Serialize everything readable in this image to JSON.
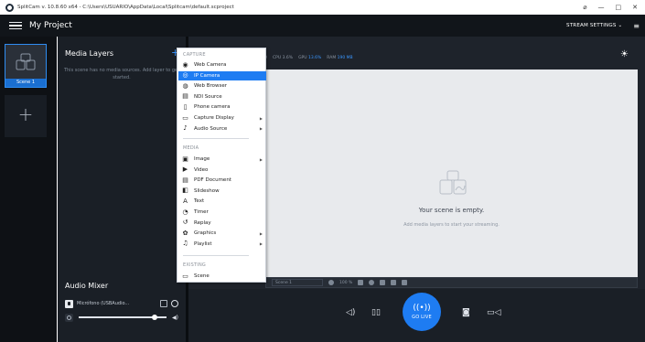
{
  "window": {
    "title": "SplitCam v. 10.8.60 x64 - C:\\Users\\USUARIO\\AppData\\Local\\Splitcam\\default.scproject",
    "minimize": "—",
    "maximize": "□",
    "close": "✕",
    "pin": "⌀"
  },
  "header": {
    "project_title": "My Project",
    "stream_settings": "STREAM SETTINGS  ⌄"
  },
  "scenes": {
    "items": [
      {
        "label": "Scene 1"
      }
    ],
    "add_label": "+"
  },
  "layers": {
    "title": "Media Layers",
    "add_label": "+",
    "empty_text": "This scene has no media sources. Add layer to get started."
  },
  "stats": {
    "fps": "5 10",
    "cpu_label": "CPU",
    "cpu": "3.6%",
    "gpu_label": "GPU",
    "gpu": "13.6%",
    "ram_label": "RAM",
    "ram": "190 MB"
  },
  "canvas": {
    "empty_title": "Your scene is empty.",
    "empty_sub": "Add media layers to start your streaming.",
    "scene_select": "Scene 1",
    "zoom": "100 %"
  },
  "audio": {
    "title": "Audio Mixer",
    "device": "Micrófono (USBAudio...",
    "volume": 0.86
  },
  "bottom": {
    "go_live": "GO LIVE"
  },
  "menu": {
    "capture_header": "CAPTURE",
    "media_header": "MEDIA",
    "existing_header": "EXISTING",
    "capture_items": [
      {
        "label": "Web Camera",
        "icon": "webcam-icon",
        "glyph": "◉",
        "submenu": false,
        "active": false
      },
      {
        "label": "IP Camera",
        "icon": "ip-camera-icon",
        "glyph": "◎",
        "submenu": false,
        "active": true
      },
      {
        "label": "Web Browser",
        "icon": "globe-icon",
        "glyph": "◍",
        "submenu": false,
        "active": false
      },
      {
        "label": "NDI Source",
        "icon": "ndi-icon",
        "glyph": "▤",
        "submenu": false,
        "active": false
      },
      {
        "label": "Phone camera",
        "icon": "phone-icon",
        "glyph": "▯",
        "submenu": false,
        "active": false
      },
      {
        "label": "Capture Display",
        "icon": "monitor-icon",
        "glyph": "▭",
        "submenu": true,
        "active": false
      },
      {
        "label": "Audio Source",
        "icon": "microphone-icon",
        "glyph": "♪",
        "submenu": true,
        "active": false
      }
    ],
    "media_items": [
      {
        "label": "Image",
        "icon": "image-icon",
        "glyph": "▣",
        "submenu": true
      },
      {
        "label": "Video",
        "icon": "video-icon",
        "glyph": "▶",
        "submenu": false
      },
      {
        "label": "PDF Document",
        "icon": "pdf-icon",
        "glyph": "▤",
        "submenu": false
      },
      {
        "label": "Slideshow",
        "icon": "slideshow-icon",
        "glyph": "◧",
        "submenu": false
      },
      {
        "label": "Text",
        "icon": "text-icon",
        "glyph": "A",
        "submenu": false
      },
      {
        "label": "Timer",
        "icon": "timer-icon",
        "glyph": "◔",
        "submenu": false
      },
      {
        "label": "Replay",
        "icon": "replay-icon",
        "glyph": "↺",
        "submenu": false
      },
      {
        "label": "Graphics",
        "icon": "graphics-icon",
        "glyph": "✿",
        "submenu": true
      },
      {
        "label": "Playlist",
        "icon": "playlist-icon",
        "glyph": "♫",
        "submenu": true
      }
    ],
    "existing_items": [
      {
        "label": "Scene",
        "icon": "scene-icon",
        "glyph": "▭",
        "submenu": false
      }
    ],
    "submenu_arrow": "▶"
  },
  "colors": {
    "accent": "#1e7cf2",
    "panel": "#1a1f26",
    "stage": "#1e232b"
  }
}
